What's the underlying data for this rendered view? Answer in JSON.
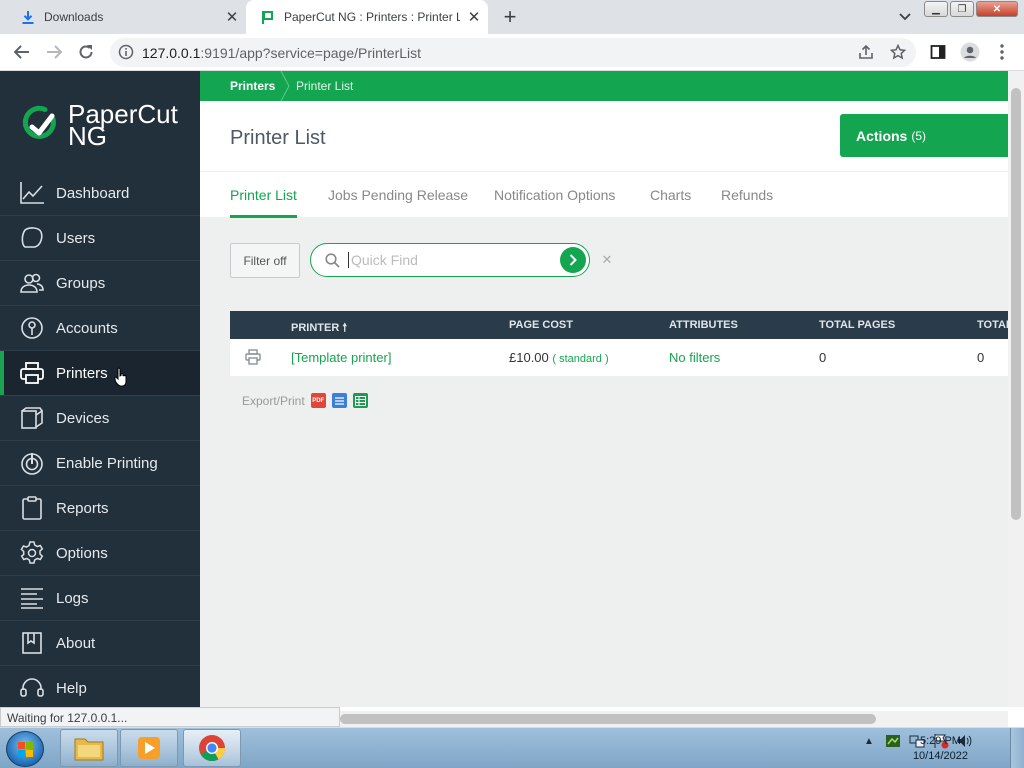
{
  "browser": {
    "tabs": [
      {
        "title": "Downloads",
        "icon": "download-icon"
      },
      {
        "title": "PaperCut NG : Printers : Printer L",
        "icon": "papercut-flag-icon",
        "active": true
      }
    ],
    "url_host": "127.0.0.1",
    "url_rest": ":9191/app?service=page/PrinterList"
  },
  "app": {
    "logo_line1": "PaperCut",
    "logo_line2": "NG",
    "nav": [
      {
        "label": "Dashboard",
        "icon": "dashboard-icon"
      },
      {
        "label": "Users",
        "icon": "users-icon"
      },
      {
        "label": "Groups",
        "icon": "groups-icon"
      },
      {
        "label": "Accounts",
        "icon": "accounts-icon"
      },
      {
        "label": "Printers",
        "icon": "printer-icon",
        "active": true
      },
      {
        "label": "Devices",
        "icon": "devices-icon"
      },
      {
        "label": "Enable Printing",
        "icon": "enable-printing-icon"
      },
      {
        "label": "Reports",
        "icon": "reports-icon"
      },
      {
        "label": "Options",
        "icon": "options-gear-icon"
      },
      {
        "label": "Logs",
        "icon": "logs-icon"
      },
      {
        "label": "About",
        "icon": "about-icon"
      },
      {
        "label": "Help",
        "icon": "help-headset-icon"
      }
    ],
    "breadcrumb": [
      "Printers",
      "Printer List"
    ],
    "page_title": "Printer List",
    "actions_label": "Actions",
    "actions_count": "(5)",
    "tabs": [
      "Printer List",
      "Jobs Pending Release",
      "Notification Options",
      "Charts",
      "Refunds"
    ],
    "filter_label": "Filter off",
    "quick_find_placeholder": "Quick Find",
    "table": {
      "columns": [
        "PRINTER",
        "PAGE COST",
        "ATTRIBUTES",
        "TOTAL PAGES",
        "TOTAL"
      ],
      "rows": [
        {
          "printer": "[Template printer]",
          "page_cost": "£10.00",
          "cost_type": "( standard )",
          "attributes": "No filters",
          "total_pages": "0",
          "total": "0"
        }
      ]
    },
    "export_label": "Export/Print",
    "export_icons": [
      "pdf-icon",
      "html-icon",
      "csv-icon"
    ]
  },
  "status_text": "Waiting for 127.0.0.1...",
  "taskbar": {
    "time": "5:29 PM",
    "date": "10/14/2022"
  },
  "colors": {
    "brand_green": "#13a54f",
    "sidebar_bg": "#22303c",
    "table_header_bg": "#2a3b49"
  }
}
